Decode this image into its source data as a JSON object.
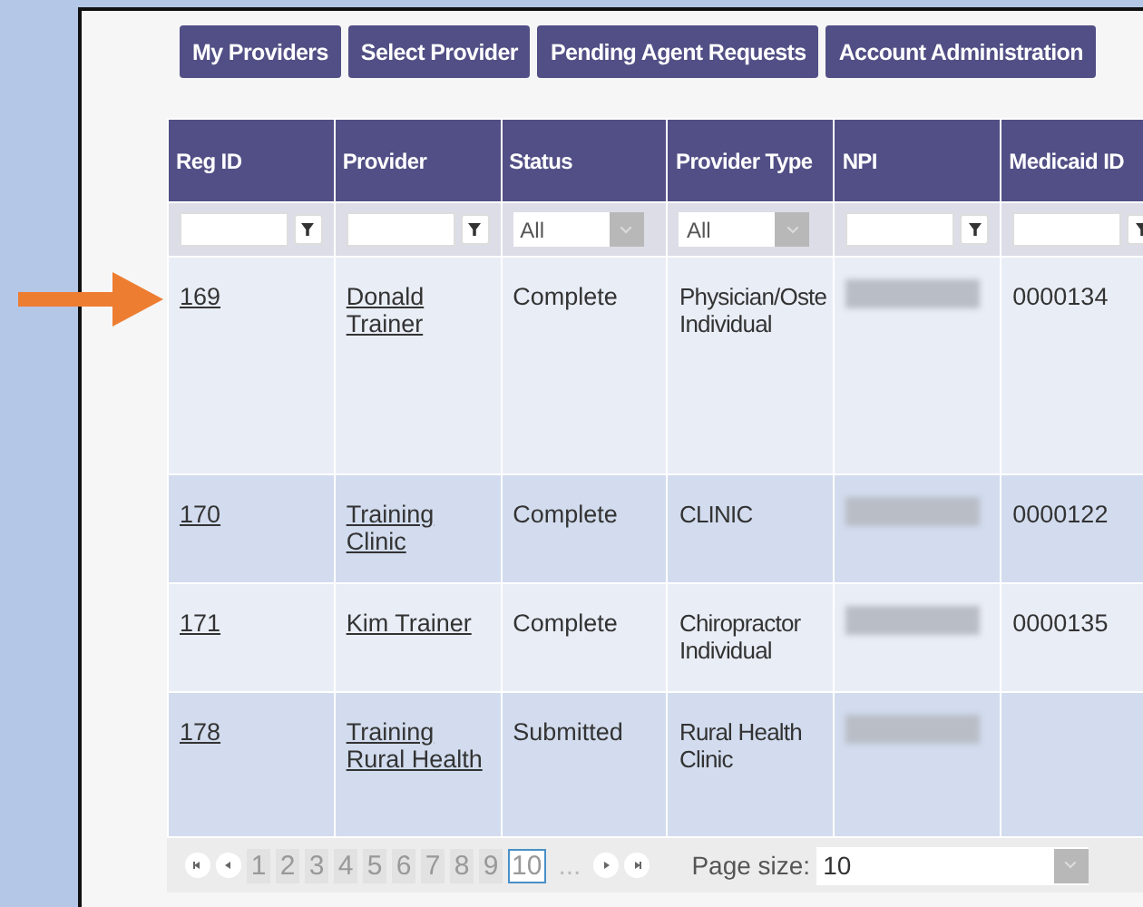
{
  "nav_buttons": [
    "My Providers",
    "Select Provider",
    "Pending Agent Requests",
    "Account Administration"
  ],
  "table": {
    "columns": [
      {
        "label": "Reg ID",
        "filter": {
          "kind": "text"
        }
      },
      {
        "label": "Provider",
        "filter": {
          "kind": "text"
        }
      },
      {
        "label": "Status",
        "filter": {
          "kind": "select",
          "value": "All"
        }
      },
      {
        "label": "Provider Type",
        "filter": {
          "kind": "select",
          "value": "All"
        }
      },
      {
        "label": "NPI",
        "filter": {
          "kind": "text"
        }
      },
      {
        "label": "Medicaid ID",
        "filter": {
          "kind": "text"
        }
      }
    ],
    "rows": [
      {
        "reg_id": "169",
        "provider": "Donald Trainer",
        "status": "Complete",
        "provider_type": "Physician/Oste Individual",
        "npi_hidden": true,
        "medicaid_id": "0000134",
        "pointed": true
      },
      {
        "reg_id": "170",
        "provider": "Training Clinic",
        "status": "Complete",
        "provider_type": "CLINIC",
        "npi_hidden": true,
        "medicaid_id": "0000122",
        "pointed": false
      },
      {
        "reg_id": "171",
        "provider": "Kim Trainer",
        "status": "Complete",
        "provider_type": "Chiropractor Individual",
        "npi_hidden": true,
        "medicaid_id": "0000135",
        "pointed": false
      },
      {
        "reg_id": "178",
        "provider": "Training Rural Health",
        "status": "Submitted",
        "provider_type": "Rural Health Clinic",
        "npi_hidden": true,
        "pointed": false
      }
    ]
  },
  "pager": {
    "pages": [
      {
        "label": "1",
        "selected": false
      },
      {
        "label": "2",
        "selected": false
      },
      {
        "label": "3",
        "selected": false
      },
      {
        "label": "4",
        "selected": false
      },
      {
        "label": "5",
        "selected": false
      },
      {
        "label": "6",
        "selected": false
      },
      {
        "label": "7",
        "selected": false
      },
      {
        "label": "8",
        "selected": false
      },
      {
        "label": "9",
        "selected": false
      },
      {
        "label": "10",
        "selected": true
      }
    ],
    "ellipsis": "...",
    "page_size_label": "Page size:",
    "page_size": "10"
  }
}
